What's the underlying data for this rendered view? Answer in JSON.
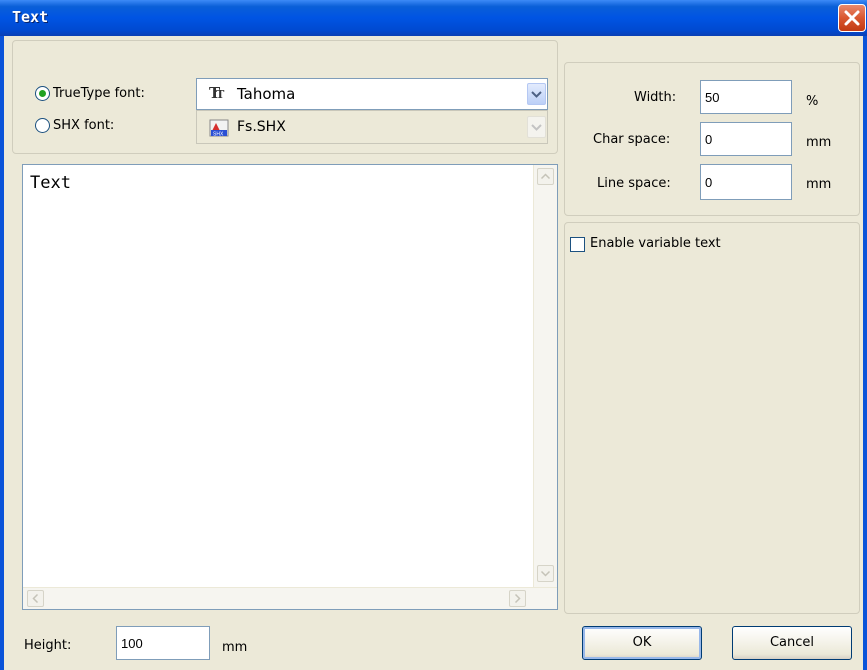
{
  "window": {
    "title": "Text"
  },
  "font": {
    "truetype_label": "TrueType font:",
    "shx_label": "SHX font:",
    "truetype_value": "Tahoma",
    "shx_value": "Fs.SHX",
    "selected": "truetype"
  },
  "editor": {
    "text": "Text"
  },
  "spacing": {
    "width_label": "Width:",
    "width_value": "50",
    "width_unit": "%",
    "char_label": "Char space:",
    "char_value": "0",
    "char_unit": "mm",
    "line_label": "Line space:",
    "line_value": "0",
    "line_unit": "mm"
  },
  "variable_text": {
    "label": "Enable variable text",
    "checked": false
  },
  "height": {
    "label": "Height:",
    "value": "100",
    "unit": "mm"
  },
  "buttons": {
    "ok": "OK",
    "cancel": "Cancel"
  }
}
